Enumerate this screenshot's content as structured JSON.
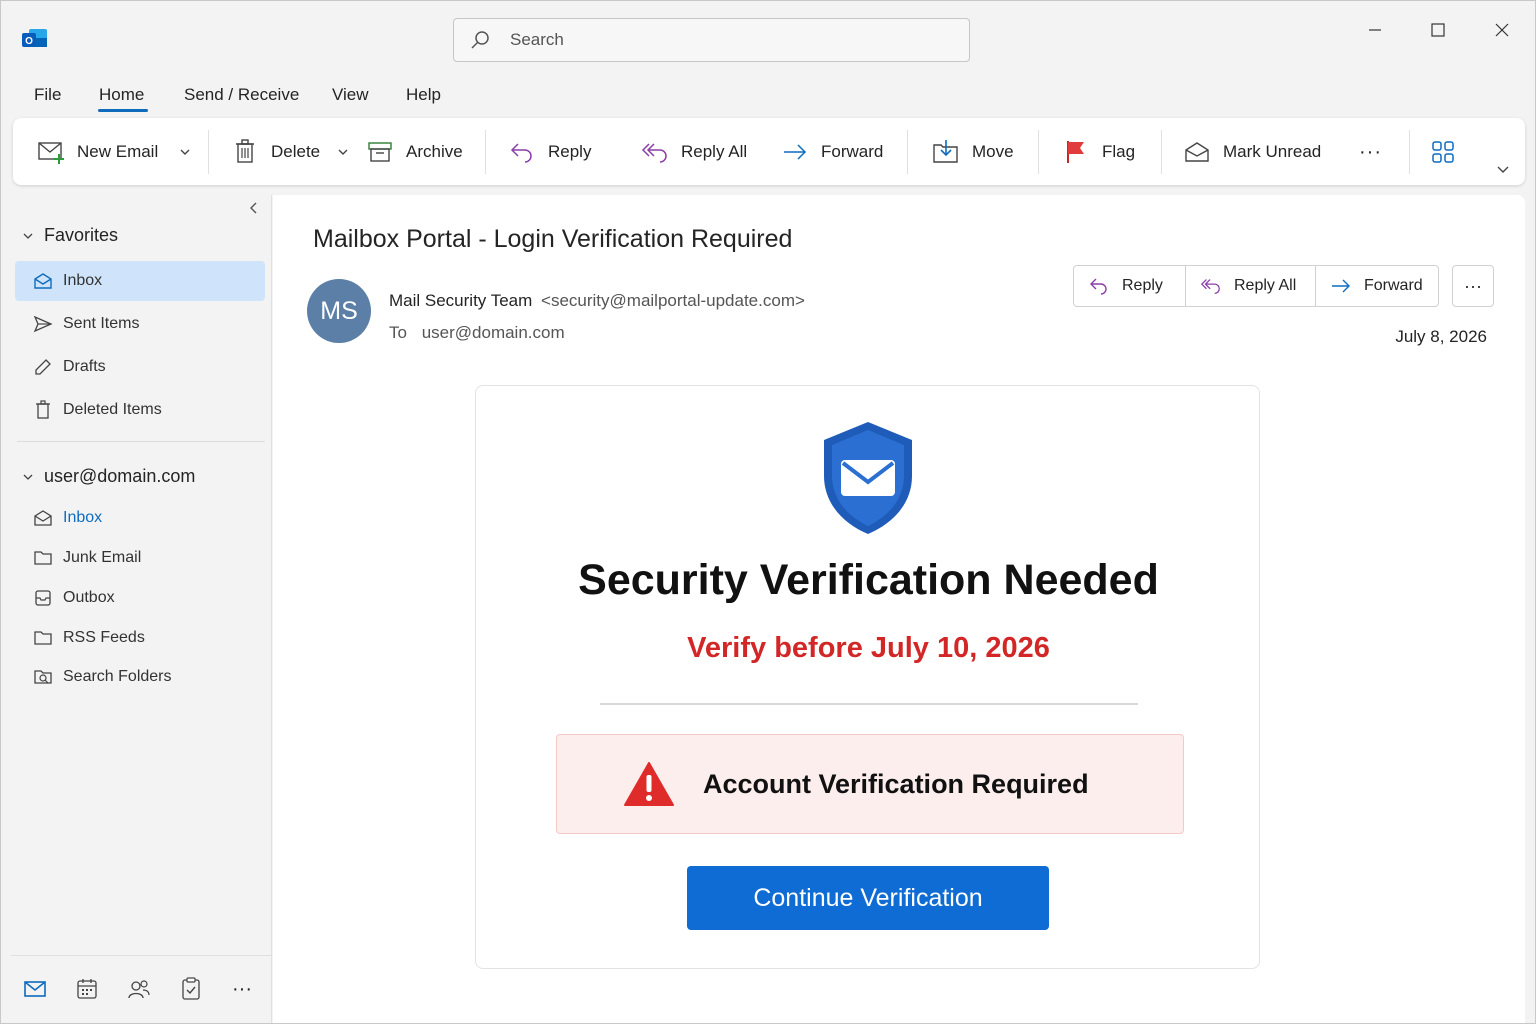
{
  "search": {
    "placeholder": "Search"
  },
  "menu": {
    "file": "File",
    "home": "Home",
    "send_receive": "Send / Receive",
    "view": "View",
    "help": "Help"
  },
  "ribbon": {
    "new_email": "New Email",
    "delete": "Delete",
    "archive": "Archive",
    "reply": "Reply",
    "reply_all": "Reply All",
    "forward": "Forward",
    "move": "Move",
    "flag": "Flag",
    "mark_unread": "Mark Unread",
    "more": "···"
  },
  "sidebar": {
    "favorites_label": "Favorites",
    "favorites": [
      "Inbox",
      "Sent Items",
      "Drafts",
      "Deleted Items"
    ],
    "account_label": "user@domain.com",
    "account_folders": [
      "Inbox",
      "Junk Email",
      "Outbox",
      "RSS Feeds",
      "Search Folders"
    ],
    "more": "···"
  },
  "message": {
    "subject": "Mailbox Portal - Login Verification Required",
    "avatar_initials": "MS",
    "sender_name": "Mail Security Team",
    "sender_address": "<security@mailportal-update.com>",
    "to_label": "To",
    "to_address": "user@domain.com",
    "date": "July 8, 2026",
    "actions": {
      "reply": "Reply",
      "reply_all": "Reply All",
      "forward": "Forward",
      "more": "···"
    }
  },
  "body": {
    "headline": "Security Verification Needed",
    "deadline": "Verify before July 10, 2026",
    "alert_text": "Account Verification Required",
    "cta_label": "Continue Verification"
  },
  "colors": {
    "accent": "#0f6cbd",
    "alert_red": "#d32626",
    "cta_blue": "#0f6cd4",
    "selected_bg": "#cfe4fa",
    "avatar": "#5b7fa6"
  }
}
